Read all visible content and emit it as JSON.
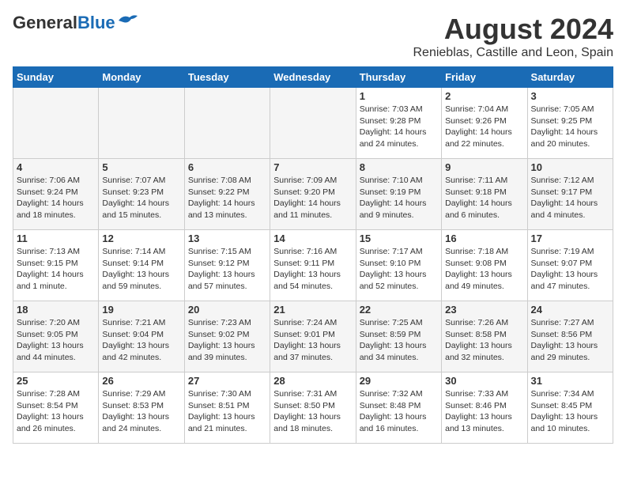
{
  "header": {
    "logo_line1": "General",
    "logo_line2": "Blue",
    "title": "August 2024",
    "subtitle": "Renieblas, Castille and Leon, Spain"
  },
  "days_of_week": [
    "Sunday",
    "Monday",
    "Tuesday",
    "Wednesday",
    "Thursday",
    "Friday",
    "Saturday"
  ],
  "weeks": [
    {
      "days": [
        {
          "number": "",
          "info": ""
        },
        {
          "number": "",
          "info": ""
        },
        {
          "number": "",
          "info": ""
        },
        {
          "number": "",
          "info": ""
        },
        {
          "number": "1",
          "info": "Sunrise: 7:03 AM\nSunset: 9:28 PM\nDaylight: 14 hours\nand 24 minutes."
        },
        {
          "number": "2",
          "info": "Sunrise: 7:04 AM\nSunset: 9:26 PM\nDaylight: 14 hours\nand 22 minutes."
        },
        {
          "number": "3",
          "info": "Sunrise: 7:05 AM\nSunset: 9:25 PM\nDaylight: 14 hours\nand 20 minutes."
        }
      ]
    },
    {
      "days": [
        {
          "number": "4",
          "info": "Sunrise: 7:06 AM\nSunset: 9:24 PM\nDaylight: 14 hours\nand 18 minutes."
        },
        {
          "number": "5",
          "info": "Sunrise: 7:07 AM\nSunset: 9:23 PM\nDaylight: 14 hours\nand 15 minutes."
        },
        {
          "number": "6",
          "info": "Sunrise: 7:08 AM\nSunset: 9:22 PM\nDaylight: 14 hours\nand 13 minutes."
        },
        {
          "number": "7",
          "info": "Sunrise: 7:09 AM\nSunset: 9:20 PM\nDaylight: 14 hours\nand 11 minutes."
        },
        {
          "number": "8",
          "info": "Sunrise: 7:10 AM\nSunset: 9:19 PM\nDaylight: 14 hours\nand 9 minutes."
        },
        {
          "number": "9",
          "info": "Sunrise: 7:11 AM\nSunset: 9:18 PM\nDaylight: 14 hours\nand 6 minutes."
        },
        {
          "number": "10",
          "info": "Sunrise: 7:12 AM\nSunset: 9:17 PM\nDaylight: 14 hours\nand 4 minutes."
        }
      ]
    },
    {
      "days": [
        {
          "number": "11",
          "info": "Sunrise: 7:13 AM\nSunset: 9:15 PM\nDaylight: 14 hours\nand 1 minute."
        },
        {
          "number": "12",
          "info": "Sunrise: 7:14 AM\nSunset: 9:14 PM\nDaylight: 13 hours\nand 59 minutes."
        },
        {
          "number": "13",
          "info": "Sunrise: 7:15 AM\nSunset: 9:12 PM\nDaylight: 13 hours\nand 57 minutes."
        },
        {
          "number": "14",
          "info": "Sunrise: 7:16 AM\nSunset: 9:11 PM\nDaylight: 13 hours\nand 54 minutes."
        },
        {
          "number": "15",
          "info": "Sunrise: 7:17 AM\nSunset: 9:10 PM\nDaylight: 13 hours\nand 52 minutes."
        },
        {
          "number": "16",
          "info": "Sunrise: 7:18 AM\nSunset: 9:08 PM\nDaylight: 13 hours\nand 49 minutes."
        },
        {
          "number": "17",
          "info": "Sunrise: 7:19 AM\nSunset: 9:07 PM\nDaylight: 13 hours\nand 47 minutes."
        }
      ]
    },
    {
      "days": [
        {
          "number": "18",
          "info": "Sunrise: 7:20 AM\nSunset: 9:05 PM\nDaylight: 13 hours\nand 44 minutes."
        },
        {
          "number": "19",
          "info": "Sunrise: 7:21 AM\nSunset: 9:04 PM\nDaylight: 13 hours\nand 42 minutes."
        },
        {
          "number": "20",
          "info": "Sunrise: 7:23 AM\nSunset: 9:02 PM\nDaylight: 13 hours\nand 39 minutes."
        },
        {
          "number": "21",
          "info": "Sunrise: 7:24 AM\nSunset: 9:01 PM\nDaylight: 13 hours\nand 37 minutes."
        },
        {
          "number": "22",
          "info": "Sunrise: 7:25 AM\nSunset: 8:59 PM\nDaylight: 13 hours\nand 34 minutes."
        },
        {
          "number": "23",
          "info": "Sunrise: 7:26 AM\nSunset: 8:58 PM\nDaylight: 13 hours\nand 32 minutes."
        },
        {
          "number": "24",
          "info": "Sunrise: 7:27 AM\nSunset: 8:56 PM\nDaylight: 13 hours\nand 29 minutes."
        }
      ]
    },
    {
      "days": [
        {
          "number": "25",
          "info": "Sunrise: 7:28 AM\nSunset: 8:54 PM\nDaylight: 13 hours\nand 26 minutes."
        },
        {
          "number": "26",
          "info": "Sunrise: 7:29 AM\nSunset: 8:53 PM\nDaylight: 13 hours\nand 24 minutes."
        },
        {
          "number": "27",
          "info": "Sunrise: 7:30 AM\nSunset: 8:51 PM\nDaylight: 13 hours\nand 21 minutes."
        },
        {
          "number": "28",
          "info": "Sunrise: 7:31 AM\nSunset: 8:50 PM\nDaylight: 13 hours\nand 18 minutes."
        },
        {
          "number": "29",
          "info": "Sunrise: 7:32 AM\nSunset: 8:48 PM\nDaylight: 13 hours\nand 16 minutes."
        },
        {
          "number": "30",
          "info": "Sunrise: 7:33 AM\nSunset: 8:46 PM\nDaylight: 13 hours\nand 13 minutes."
        },
        {
          "number": "31",
          "info": "Sunrise: 7:34 AM\nSunset: 8:45 PM\nDaylight: 13 hours\nand 10 minutes."
        }
      ]
    }
  ]
}
